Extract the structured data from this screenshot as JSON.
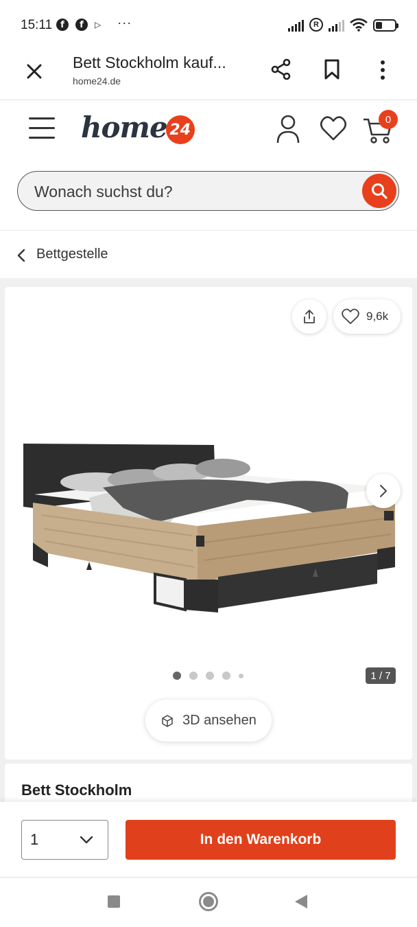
{
  "status_bar": {
    "time": "15:11",
    "notification_icons": [
      "facebook-icon",
      "facebook-icon",
      "play-store-icon"
    ],
    "more": "···",
    "right_icons": [
      "signal-icon",
      "registered-icon",
      "signal-icon",
      "wifi-icon",
      "battery-icon"
    ],
    "battery_level": 0.35
  },
  "browser_tab": {
    "title": "Bett Stockholm kauf...",
    "url": "home24.de"
  },
  "header": {
    "logo_word": "home",
    "logo_badge": "24",
    "cart_count": "0"
  },
  "search": {
    "placeholder": "Wonach suchst du?"
  },
  "breadcrumb": {
    "label": "Bettgestelle"
  },
  "gallery": {
    "favorite_count": "9,6k",
    "counter": "1 / 7",
    "view_3d_label": "3D ansehen",
    "dots_total": 5,
    "active_dot": 0
  },
  "product": {
    "title": "Bett Stockholm"
  },
  "buy_bar": {
    "quantity": "1",
    "cart_button_label": "In den Warenkorb"
  },
  "colors": {
    "brand_red": "#e8401c",
    "logo_text": "#2b3440"
  }
}
